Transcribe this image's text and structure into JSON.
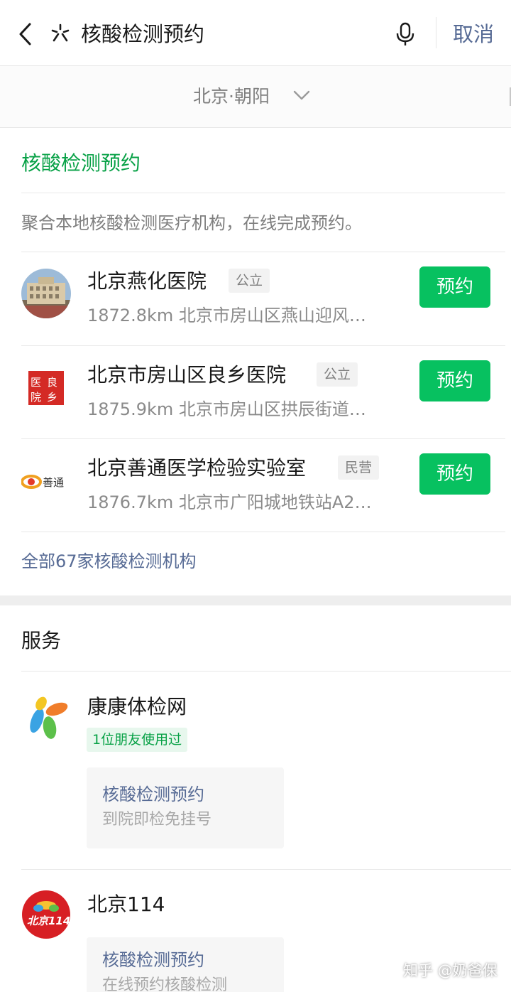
{
  "search_bar": {
    "query": "核酸检测预约",
    "cancel_label": "取消",
    "back_icon": "back-arrow-icon",
    "type_icon": "search-function-icon",
    "voice_icon": "microphone-icon"
  },
  "location": {
    "label": "北京·朝阳",
    "icon": "chevron-down-icon"
  },
  "nucleic_card": {
    "title": "核酸检测预约",
    "description": "聚合本地核酸检测医疗机构，在线完成预约。",
    "hospitals": [
      {
        "name": "北京燕化医院",
        "tag": "公立",
        "distance_address": "1872.8km  北京市房山区燕山迎风…",
        "button": "预约"
      },
      {
        "name": "北京市房山区良乡医院",
        "tag": "公立",
        "distance_address": "1875.9km  北京市房山区拱辰街道…",
        "button": "预约"
      },
      {
        "name": "北京善通医学检验实验室",
        "tag": "民营",
        "distance_address": "1876.7km  北京市广阳城地铁站A2…",
        "button": "预约"
      }
    ],
    "all_link": "全部67家核酸检测机构"
  },
  "services": {
    "header": "服务",
    "items": [
      {
        "name": "康康体检网",
        "badge": "1位朋友使用过",
        "card_title": "核酸检测预约",
        "card_subtitle": "到院即检免挂号"
      },
      {
        "name": "北京114",
        "card_title": "核酸检测预约",
        "card_subtitle": "在线预约核酸检测"
      }
    ]
  },
  "logos": {
    "hospital_2_text": "医良院乡",
    "hospital_3_text": "善通",
    "service_2_text": "北京114"
  },
  "watermark": "知乎 @奶爸保",
  "colors": {
    "accent_green": "#07c160",
    "title_green": "#07a146",
    "link_blue": "#576b95"
  }
}
